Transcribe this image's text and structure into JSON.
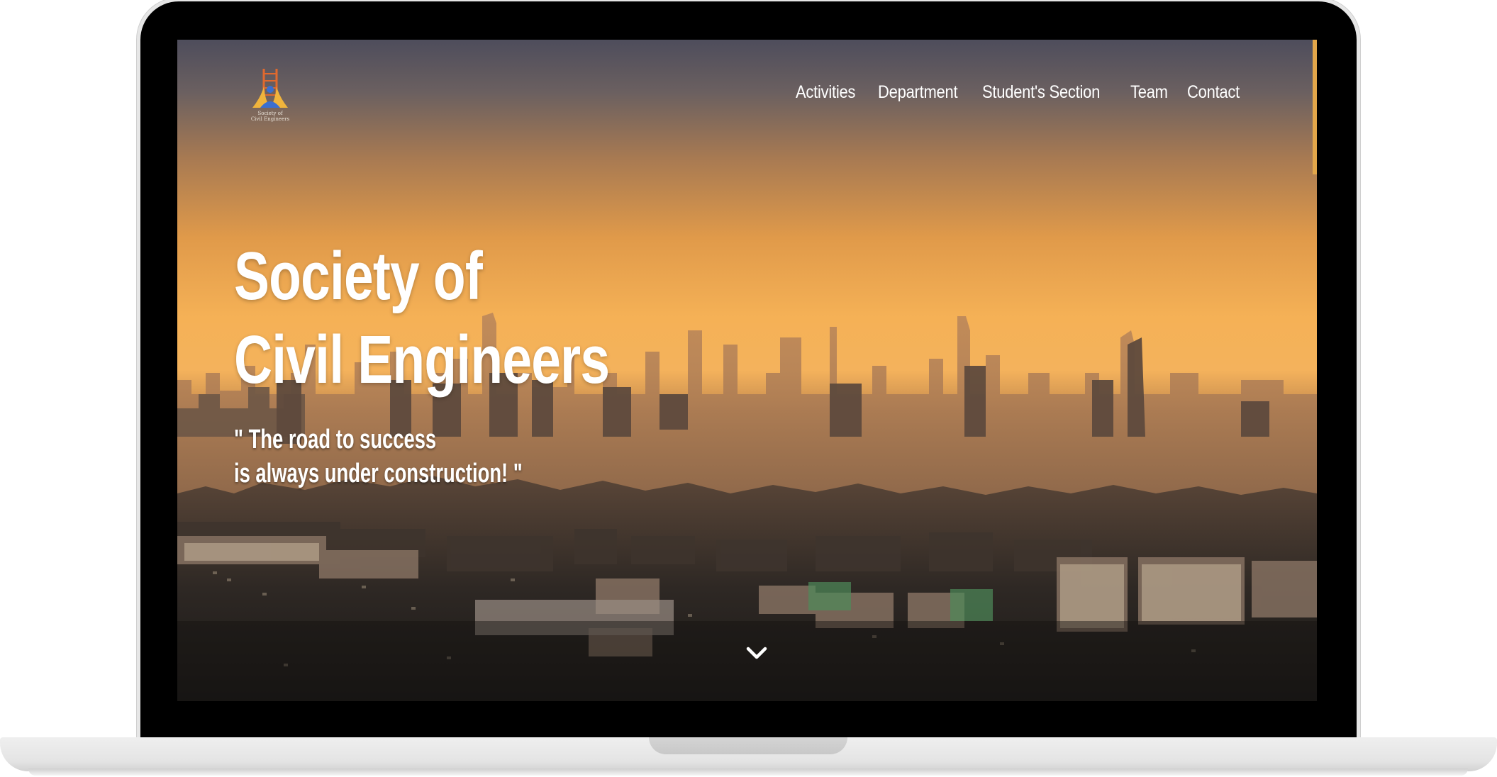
{
  "site": {
    "logo_caption_line1": "Society of",
    "logo_caption_line2": "Civil Engineers"
  },
  "nav": {
    "items": [
      {
        "label": "Activities"
      },
      {
        "label": "Department"
      },
      {
        "label": "Student's Section"
      },
      {
        "label": "Team"
      },
      {
        "label": "Contact"
      }
    ]
  },
  "hero": {
    "title_line1": "Society of",
    "title_line2": "Civil Engineers",
    "quote_line1": "\" The road to success",
    "quote_line2": "is always under construction! \""
  },
  "icons": {
    "scroll_down": "chevron-down-icon",
    "logo": "logo-icon"
  },
  "colors": {
    "accent": "#e2a64a",
    "sky_top": "#4e4d5c",
    "sky_glow": "#f5b156",
    "text": "#ffffff"
  }
}
